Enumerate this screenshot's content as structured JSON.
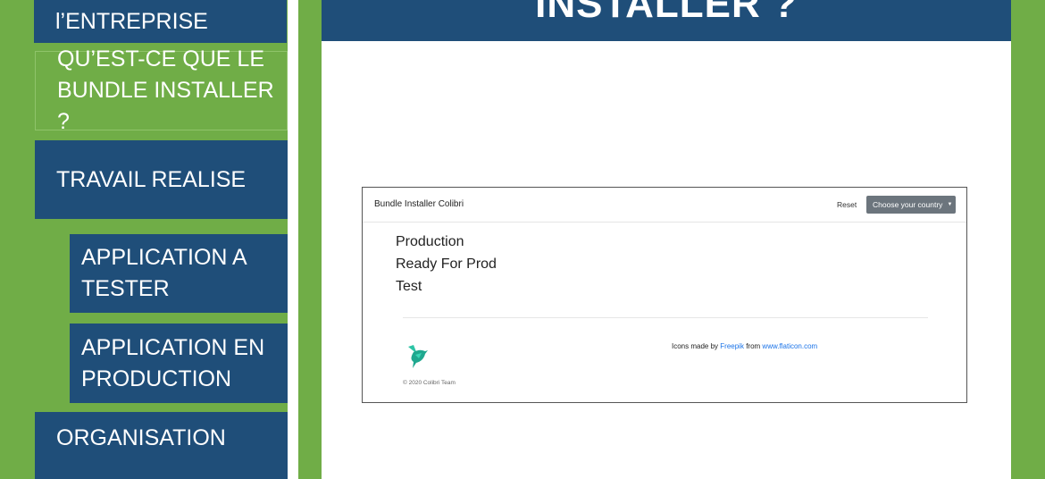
{
  "sidebar": {
    "items": [
      {
        "label": "l’ENTREPRISE"
      },
      {
        "label": "QU’EST-CE QUE LE BUNDLE INSTALLER ?"
      },
      {
        "label": "TRAVAIL REALISE"
      },
      {
        "label": "APPLICATION A TESTER"
      },
      {
        "label": "APPLICATION EN PRODUCTION"
      },
      {
        "label": "ORGANISATION"
      }
    ]
  },
  "header": {
    "title": "INSTALLER ?"
  },
  "app": {
    "brand": "Bundle Installer Colibri",
    "reset_label": "Reset",
    "dropdown_label": "Choose your country",
    "environments": [
      "Production",
      "Ready For Prod",
      "Test"
    ],
    "credits": {
      "prefix": "Icons made by",
      "author": "Freepik",
      "middle": "from",
      "site": "www.flaticon.com"
    },
    "copyright": "© 2020 Colibri Team",
    "bird_icon": "hummingbird-logo-icon"
  },
  "colors": {
    "blue": "#1f4e79",
    "green": "#70ad47",
    "link": "#1a73e8",
    "dropdown": "#6c757d"
  }
}
